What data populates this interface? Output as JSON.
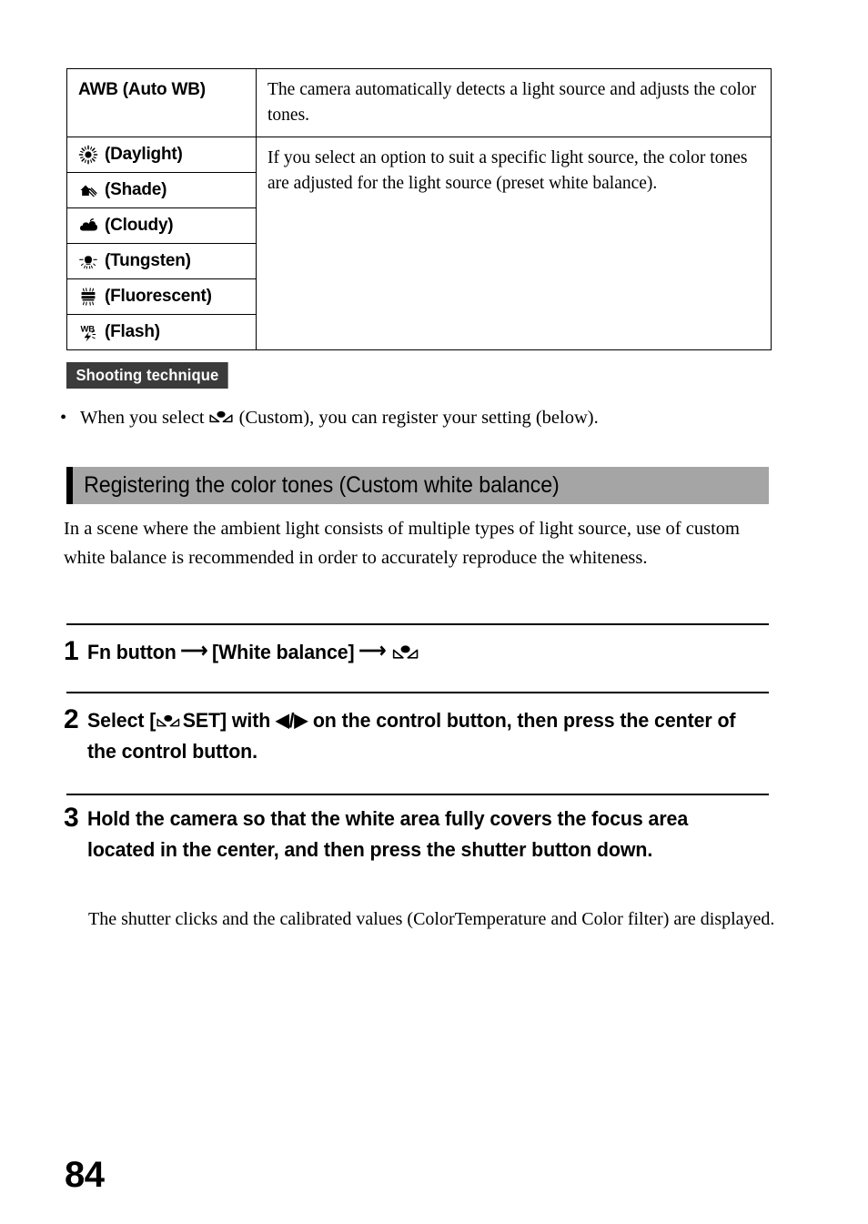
{
  "document": {
    "page_number": "84",
    "accent_color": "#a5a5a5",
    "badge_color": "#3b3b3b"
  },
  "wb_table": {
    "rows": [
      {
        "icon": "none",
        "label": "AWB (Auto WB)",
        "description": "The camera automatically detects a light source and adjusts the color tones."
      },
      {
        "icon": "sun-icon",
        "label": "(Daylight)"
      },
      {
        "icon": "shade-house-icon",
        "label": "(Shade)"
      },
      {
        "icon": "cloud-icon",
        "label": "(Cloudy)"
      },
      {
        "icon": "tungsten-bulb-icon",
        "label": "(Tungsten)"
      },
      {
        "icon": "fluorescent-tube-icon",
        "label": "(Fluorescent)"
      },
      {
        "icon": "flash-wb-icon",
        "label": "(Flash)"
      }
    ],
    "preset_description": "If you select an option to suit a specific light source, the color tones are adjusted for the light source (preset white balance)."
  },
  "shooting_technique": {
    "badge_label": "Shooting technique",
    "bullet_marker": "•",
    "bullet_before_icon": "When you select",
    "bullet_icon": "custom-wb-icon",
    "bullet_after_icon": "(Custom), you can register your setting (below)."
  },
  "section": {
    "title": "Registering the color tones (Custom white balance)",
    "intro": "In a scene where the ambient light consists of multiple types of light source, use of custom white balance is recommended in order to accurately reproduce the whiteness."
  },
  "steps": [
    {
      "number": "1",
      "part_1": "Fn button",
      "arrow_1": "⟶",
      "part_2": "[White balance]",
      "arrow_2": "⟶",
      "trailing_icon": "custom-wb-icon"
    },
    {
      "number": "2",
      "part_1": "Select [",
      "icon": "custom-wb-icon",
      "part_2": "SET] with",
      "arrow_left": "◀",
      "slash": "/",
      "arrow_right": "▶",
      "part_3": "on the control button, then press the center of the control button."
    },
    {
      "number": "3",
      "text": "Hold the camera so that the white area fully covers the focus area located in the center, and then press the shutter button down."
    }
  ],
  "note": "The shutter clicks and the calibrated values (ColorTemperature and Color filter) are displayed."
}
